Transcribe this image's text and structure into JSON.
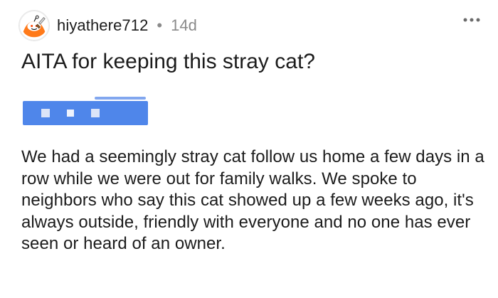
{
  "post": {
    "author": {
      "username": "hiyathere712",
      "separator": "•",
      "age": "14d",
      "avatar_icon": "reddit-snoo-avatar-icon"
    },
    "menu_icon": "more-horizontal-icon",
    "title": "AITA for keeping this stray cat?",
    "body": "We had a seemingly stray cat follow us home a few days in a row while we were out for family walks. We spoke to neighbors who say this cat showed up a few weeks ago, it's always outside, friendly with everyone and no one has ever seen or heard of an owner.",
    "flair": {
      "color": "#4f86ea"
    }
  }
}
